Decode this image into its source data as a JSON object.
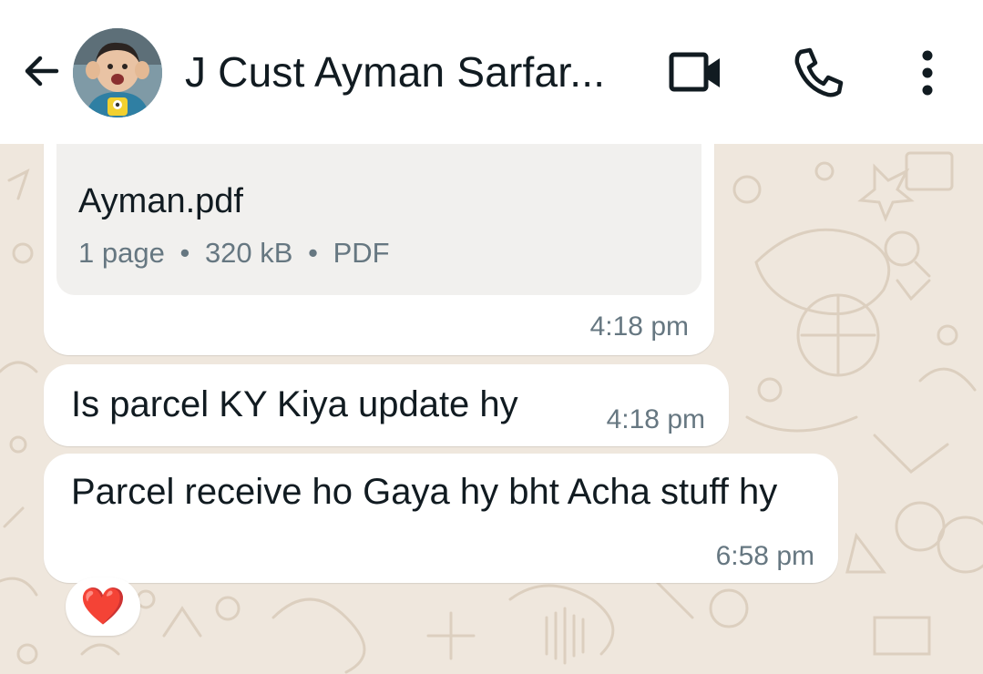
{
  "header": {
    "contact_name": "J Cust Ayman Sarfar...",
    "back_icon": "arrow-left-icon",
    "video_icon": "video-camera-icon",
    "call_icon": "phone-icon",
    "menu_icon": "more-vertical-icon",
    "avatar": "contact-avatar"
  },
  "messages": {
    "document": {
      "file_name": "Ayman.pdf",
      "pages": "1 page",
      "size": "320 kB",
      "type": "PDF",
      "separator": "•",
      "time": "4:18 pm"
    },
    "msg1": {
      "text": "Is parcel KY Kiya update hy",
      "time": "4:18 pm"
    },
    "msg2": {
      "text": "Parcel receive ho Gaya hy bht Acha stuff hy",
      "time": "6:58 pm",
      "reaction": "❤️",
      "reaction_icon": "heart-icon"
    }
  },
  "colors": {
    "header_bg": "#ffffff",
    "chat_bg": "#efe7dd",
    "bubble_bg": "#ffffff",
    "doc_card_bg": "#f1f0ee",
    "meta_text": "#667781",
    "heart": "#e0245e"
  }
}
